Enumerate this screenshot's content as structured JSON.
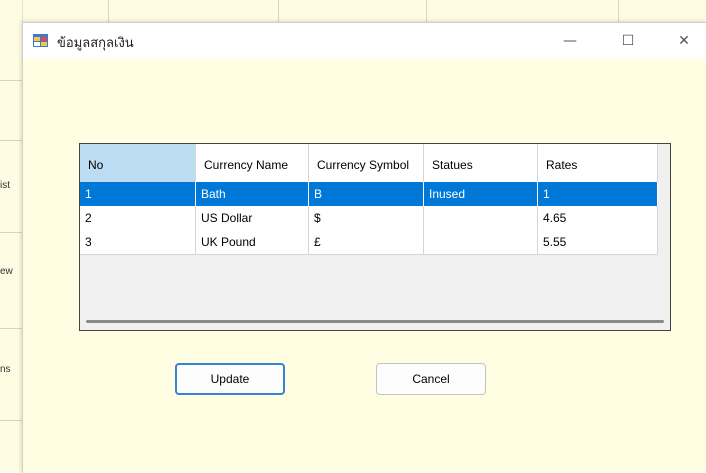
{
  "background": {
    "strip_labels": [
      "ist",
      "ew",
      "ns"
    ]
  },
  "dialog": {
    "title": "ข้อมูลสกุลเงิน",
    "window_controls": {
      "minimize": "—",
      "maximize": "☐",
      "close": "✕"
    }
  },
  "grid": {
    "columns": [
      "No",
      "Currency Name",
      "Currency Symbol",
      "Statues",
      "Rates"
    ],
    "rows": [
      {
        "no": "1",
        "name": "Bath",
        "symbol": "B",
        "status": "Inused",
        "rate": "1",
        "selected": true
      },
      {
        "no": "2",
        "name": "US Dollar",
        "symbol": "$",
        "status": "",
        "rate": "4.65",
        "selected": false
      },
      {
        "no": "3",
        "name": "UK Pound",
        "symbol": "£",
        "status": "",
        "rate": "5.55",
        "selected": false
      }
    ]
  },
  "buttons": {
    "update": "Update",
    "cancel": "Cancel"
  },
  "colors": {
    "selection": "#0078d7",
    "form_background": "#fffee2",
    "header_selected": "#bcdcf4"
  }
}
